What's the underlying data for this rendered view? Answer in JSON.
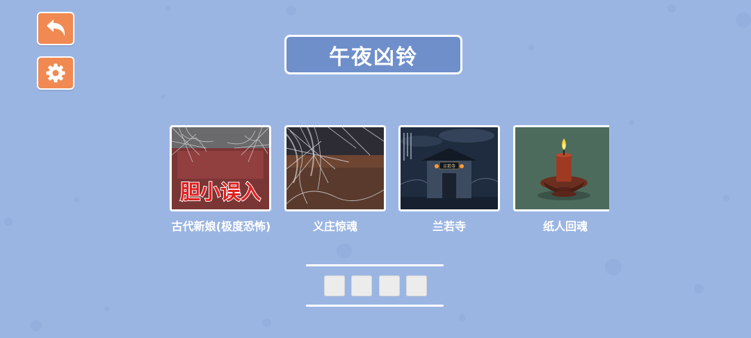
{
  "header": {
    "title": "午夜凶铃",
    "back_icon": "back-arrow-icon",
    "settings_icon": "gear-icon",
    "button_color": "#f08a52"
  },
  "levels": [
    {
      "label": "古代新娘(极度恐怖)",
      "image_text": "胆小误入",
      "image": "web-covered-red-room"
    },
    {
      "label": "义庄惊魂",
      "image": "cobweb-mortuary"
    },
    {
      "label": "兰若寺",
      "image": "haunted-temple-night",
      "plaque_text": "兰若寺"
    },
    {
      "label": "纸人回魂",
      "image": "candle-on-green"
    }
  ],
  "answer": {
    "slot_count": 4
  },
  "colors": {
    "background": "#9bb5e3",
    "title_bg": "#6f8fcb"
  }
}
